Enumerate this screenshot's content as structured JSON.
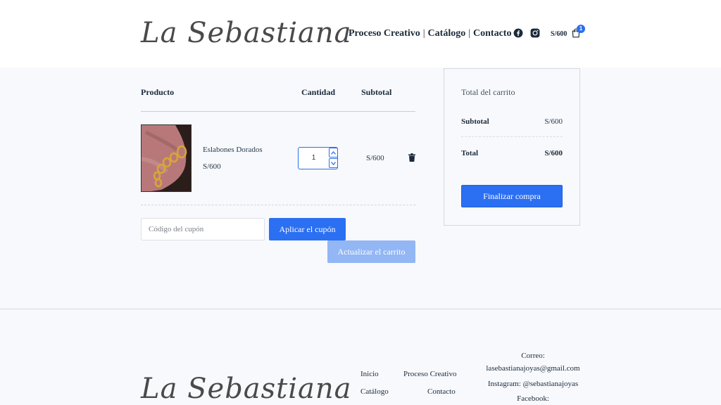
{
  "header": {
    "logo": "La Sebastiana",
    "nav": [
      {
        "label": "Proceso Creativo"
      },
      {
        "label": "Catálogo"
      },
      {
        "label": "Contacto"
      }
    ],
    "separator": "|",
    "cart_total": "S/600",
    "cart_count": "1"
  },
  "table": {
    "headers": {
      "product": "Producto",
      "quantity": "Cantidad",
      "subtotal": "Subtotal"
    },
    "items": [
      {
        "name": "Eslabones Dorados",
        "price": "S/600",
        "quantity": "1",
        "subtotal": "S/600"
      }
    ]
  },
  "coupon": {
    "placeholder": "Código del cupón",
    "apply_label": "Aplicar el cupón",
    "update_label": "Actualizar el carrito"
  },
  "totals": {
    "title": "Total del carrito",
    "subtotal_label": "Subtotal",
    "subtotal_value": "S/600",
    "total_label": "Total",
    "total_value": "S/600",
    "checkout_label": "Finalizar compra"
  },
  "footer": {
    "logo": "La Sebastiana",
    "links": [
      {
        "label": "Inicio"
      },
      {
        "label": "Proceso Creativo"
      },
      {
        "label": "Catálogo"
      },
      {
        "label": "Contacto"
      }
    ],
    "contact": {
      "email_label": "Correo:",
      "email": "lasebastianajoyas@gmail.com",
      "instagram": "Instagram: @sebastianajoyas",
      "facebook_label": "Facebook:"
    }
  },
  "colors": {
    "primary": "#2b6ff2",
    "primary_disabled": "#93b6f4",
    "text": "#1b2a3a",
    "background": "#f7f9fc"
  },
  "icons": [
    "facebook-icon",
    "instagram-icon",
    "shopping-bag-icon",
    "trash-icon",
    "chevron-up-icon",
    "chevron-down-icon"
  ]
}
